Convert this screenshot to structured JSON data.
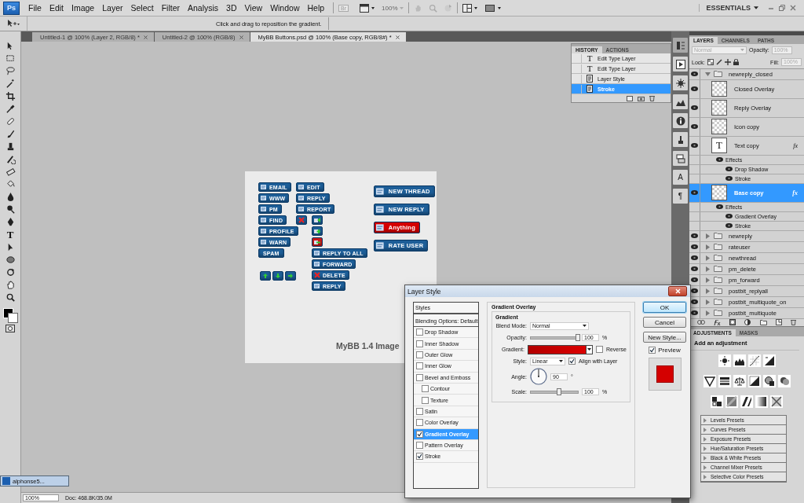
{
  "app": {
    "logo": "Ps"
  },
  "menu": [
    "File",
    "Edit",
    "Image",
    "Layer",
    "Select",
    "Filter",
    "Analysis",
    "3D",
    "View",
    "Window",
    "Help"
  ],
  "app_bar": {
    "bridge": "Br",
    "zoom": "100%",
    "workspace": "ESSENTIALS"
  },
  "options_bar": {
    "hint": "Click and drag to reposition the gradient."
  },
  "toolbar": {
    "type_tool": "T"
  },
  "document_tabs": [
    {
      "label": "Untitled-1 @ 100% (Layer 2, RGB/8) *",
      "selected": false
    },
    {
      "label": "Untitled-2 @ 100% (RGB/8)",
      "selected": false
    },
    {
      "label": "MyBB Buttons.psd @ 100% (Base copy, RGB/8#) *",
      "selected": true
    }
  ],
  "canvas": {
    "column_1": [
      {
        "kind": "text",
        "label": "EMAIL",
        "color": "#1d5e98"
      },
      {
        "kind": "text",
        "label": "WWW",
        "color": "#1d5e98"
      },
      {
        "kind": "text",
        "label": "PM",
        "color": "#1d5e98"
      },
      {
        "kind": "text",
        "label": "FIND",
        "color": "#1d5e98"
      },
      {
        "kind": "text",
        "label": "PROFILE",
        "color": "#1d5e98"
      },
      {
        "kind": "text",
        "label": "WARN",
        "color": "#1d5e98"
      },
      {
        "kind": "plain",
        "label": "SPAM",
        "color": "#1d5e98"
      }
    ],
    "arrows": [
      {
        "kind": "up",
        "color": "#1d5e98"
      },
      {
        "kind": "down",
        "color": "#1d5e98"
      },
      {
        "kind": "next",
        "color": "#1d5e98"
      }
    ],
    "column_2": [
      {
        "kind": "text",
        "label": "EDIT",
        "color": "#1d5e98"
      },
      {
        "kind": "text",
        "label": "REPLY",
        "color": "#1d5e98"
      },
      {
        "kind": "text",
        "label": "REPORT",
        "color": "#1d5e98"
      },
      {
        "kind": "delete",
        "color": "#1d5e98"
      }
    ],
    "column_3": [
      {
        "kind": "reply",
        "color": "#1d5e98"
      },
      {
        "kind": "add",
        "color": "#1d5e98"
      },
      {
        "kind": "remove",
        "color": "#cc1a1a"
      },
      {
        "kind": "text",
        "label": "REPLY TO ALL",
        "color": "#1d5e98"
      },
      {
        "kind": "text",
        "label": "FORWARD",
        "color": "#1d5e98"
      },
      {
        "kind": "delete_text",
        "label": "DELETE",
        "color": "#1d5e98"
      },
      {
        "kind": "text",
        "label": "REPLY",
        "color": "#1d5e98"
      }
    ],
    "large": [
      {
        "kind": "text",
        "label": "NEW THREAD",
        "color": "#1d5e98"
      },
      {
        "kind": "text",
        "label": "NEW REPLY",
        "color": "#1d5e98"
      },
      {
        "kind": "text",
        "label": "Anything",
        "color": "#d40000"
      },
      {
        "kind": "text",
        "label": "RATE USER",
        "color": "#1d5e98"
      }
    ],
    "caption": "MyBB 1.4 Image"
  },
  "history": {
    "tabs": [
      {
        "label": "HISTORY",
        "selected": true
      },
      {
        "label": "ACTIONS",
        "selected": false
      }
    ],
    "items": [
      {
        "kind": "type",
        "glyph": "T",
        "label": "Edit Type Layer",
        "selected": false
      },
      {
        "kind": "type",
        "glyph": "T",
        "label": "Edit Type Layer",
        "selected": false
      },
      {
        "kind": "style",
        "label": "Layer Style",
        "selected": false
      },
      {
        "kind": "style",
        "label": "Stroke",
        "selected": true
      }
    ]
  },
  "panel_strip": {
    "character": "A",
    "paragraph": "¶"
  },
  "layers": {
    "tabs": [
      {
        "label": "LAYERS",
        "selected": true
      },
      {
        "label": "CHANNELS",
        "selected": false
      },
      {
        "label": "PATHS",
        "selected": false
      }
    ],
    "blend_mode": "Normal",
    "opacity_label": "Opacity:",
    "opacity": "100%",
    "lock_label": "Lock:",
    "fill_label": "Fill:",
    "fill": "100%",
    "items": [
      {
        "kind": "group",
        "name": "newreply_closed",
        "visible": true,
        "expanded": true,
        "selected": false,
        "children": [
          {
            "kind": "pixel",
            "name": "Closed Overlay",
            "visible": true,
            "selected": false
          },
          {
            "kind": "pixel",
            "name": "Reply Overlay",
            "visible": true,
            "selected": false
          },
          {
            "kind": "pixel",
            "name": "Icon copy",
            "visible": true,
            "selected": false
          },
          {
            "kind": "text",
            "glyph": "T",
            "name": "Text copy",
            "visible": true,
            "selected": false,
            "badge": "fx",
            "effects_label": "Effects",
            "effects": [
              "Drop Shadow",
              "Stroke"
            ]
          },
          {
            "kind": "pixel",
            "name": "Base copy",
            "visible": true,
            "selected": true,
            "badge": "fx",
            "effects_label": "Effects",
            "effects": [
              "Gradient Overlay",
              "Stroke"
            ]
          }
        ]
      },
      {
        "kind": "group",
        "name": "newreply",
        "visible": true,
        "expanded": false,
        "selected": false
      },
      {
        "kind": "group",
        "name": "rateuser",
        "visible": true,
        "expanded": false,
        "selected": false
      },
      {
        "kind": "group",
        "name": "newthread",
        "visible": true,
        "expanded": false,
        "selected": false
      },
      {
        "kind": "group",
        "name": "pm_delete",
        "visible": true,
        "expanded": false,
        "selected": false
      },
      {
        "kind": "group",
        "name": "pm_forward",
        "visible": true,
        "expanded": false,
        "selected": false
      },
      {
        "kind": "group",
        "name": "postbit_replyall",
        "visible": true,
        "expanded": false,
        "selected": false
      },
      {
        "kind": "group",
        "name": "postbit_multiquote_on",
        "visible": true,
        "expanded": false,
        "selected": false
      },
      {
        "kind": "group",
        "name": "postbit_multiquote",
        "visible": true,
        "expanded": false,
        "selected": false
      }
    ]
  },
  "adjustments": {
    "tabs": [
      {
        "label": "ADJUSTMENTS",
        "selected": true
      },
      {
        "label": "MASKS",
        "selected": false
      }
    ],
    "heading": "Add an adjustment",
    "presets": [
      "Levels Presets",
      "Curves Presets",
      "Exposure Presets",
      "Hue/Saturation Presets",
      "Black & White Presets",
      "Channel Mixer Presets",
      "Selective Color Presets"
    ]
  },
  "dialog": {
    "title": "Layer Style",
    "styles_heading": "Styles",
    "blending": "Blending Options: Default",
    "styles": [
      {
        "label": "Drop Shadow",
        "checked": false,
        "selected": false
      },
      {
        "label": "Inner Shadow",
        "checked": false,
        "selected": false
      },
      {
        "label": "Outer Glow",
        "checked": false,
        "selected": false
      },
      {
        "label": "Inner Glow",
        "checked": false,
        "selected": false
      },
      {
        "label": "Bevel and Emboss",
        "checked": false,
        "selected": false,
        "children": [
          {
            "label": "Contour",
            "checked": false,
            "selected": false
          },
          {
            "label": "Texture",
            "checked": false,
            "selected": false
          }
        ]
      },
      {
        "label": "Satin",
        "checked": false,
        "selected": false
      },
      {
        "label": "Color Overlay",
        "checked": false,
        "selected": false
      },
      {
        "label": "Gradient Overlay",
        "checked": true,
        "selected": true
      },
      {
        "label": "Pattern Overlay",
        "checked": false,
        "selected": false
      },
      {
        "label": "Stroke",
        "checked": true,
        "selected": false
      }
    ],
    "section": "Gradient Overlay",
    "group": "Gradient",
    "blend_mode_label": "Blend Mode:",
    "blend_mode": "Normal",
    "opacity_label": "Opacity:",
    "opacity": {
      "level": 1,
      "value": "100",
      "unit": "%"
    },
    "gradient_label": "Gradient:",
    "reverse": {
      "label": "Reverse",
      "checked": false
    },
    "style_label": "Style:",
    "style": "Linear",
    "align": {
      "label": "Align with Layer",
      "checked": true
    },
    "angle_label": "Angle:",
    "angle": "90",
    "angle_unit": "°",
    "scale_label": "Scale:",
    "scale": {
      "level": 0.6,
      "value": "100",
      "unit": "%"
    },
    "buttons": [
      {
        "label": "OK",
        "default": true
      },
      {
        "label": "Cancel",
        "default": false
      },
      {
        "label": "New Style...",
        "default": false
      }
    ],
    "preview": {
      "label": "Preview",
      "checked": true
    }
  },
  "status_bar": {
    "zoom": "100%",
    "doc": "Doc: 468.8K/35.0M"
  },
  "minimized_document": "alphonse5..."
}
